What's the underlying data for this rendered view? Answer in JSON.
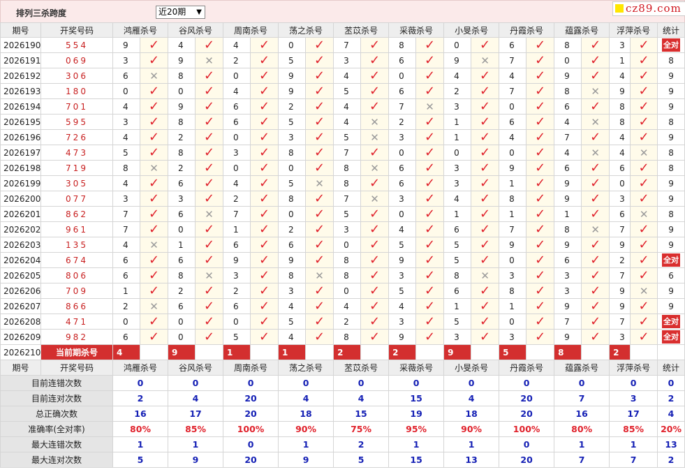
{
  "title": "排列三杀跨度",
  "period_select": "近20期",
  "logo": "cz89.com",
  "icons": {
    "correct": "check-icon",
    "wrong": "cross-icon"
  },
  "colors": {
    "accent": "#d32f2f",
    "check": "#e0212b",
    "stat_blue": "#1520b5"
  },
  "headers": [
    "期号",
    "开奖号码",
    "鸿雁杀号",
    "谷风杀号",
    "周南杀号",
    "荡之杀号",
    "苤苡杀号",
    "采薇杀号",
    "小旻杀号",
    "丹霞杀号",
    "蕴露杀号",
    "浮萍杀号",
    "统计"
  ],
  "rows": [
    {
      "id": "2026190",
      "num": "554",
      "p": [
        [
          "9",
          1
        ],
        [
          "4",
          1
        ],
        [
          "4",
          1
        ],
        [
          "0",
          1
        ],
        [
          "7",
          1
        ],
        [
          "8",
          1
        ],
        [
          "0",
          1
        ],
        [
          "6",
          1
        ],
        [
          "8",
          1
        ],
        [
          "3",
          1
        ]
      ],
      "stat": "全对"
    },
    {
      "id": "2026191",
      "num": "069",
      "p": [
        [
          "3",
          1
        ],
        [
          "9",
          0
        ],
        [
          "2",
          1
        ],
        [
          "5",
          1
        ],
        [
          "3",
          1
        ],
        [
          "6",
          1
        ],
        [
          "9",
          0
        ],
        [
          "7",
          1
        ],
        [
          "0",
          1
        ],
        [
          "1",
          1
        ]
      ],
      "stat": "8"
    },
    {
      "id": "2026192",
      "num": "306",
      "p": [
        [
          "6",
          0
        ],
        [
          "8",
          1
        ],
        [
          "0",
          1
        ],
        [
          "9",
          1
        ],
        [
          "4",
          1
        ],
        [
          "0",
          1
        ],
        [
          "4",
          1
        ],
        [
          "4",
          1
        ],
        [
          "9",
          1
        ],
        [
          "4",
          1
        ]
      ],
      "stat": "9"
    },
    {
      "id": "2026193",
      "num": "180",
      "p": [
        [
          "0",
          1
        ],
        [
          "0",
          1
        ],
        [
          "4",
          1
        ],
        [
          "9",
          1
        ],
        [
          "5",
          1
        ],
        [
          "6",
          1
        ],
        [
          "2",
          1
        ],
        [
          "7",
          1
        ],
        [
          "8",
          0
        ],
        [
          "9",
          1
        ]
      ],
      "stat": "9"
    },
    {
      "id": "2026194",
      "num": "701",
      "p": [
        [
          "4",
          1
        ],
        [
          "9",
          1
        ],
        [
          "6",
          1
        ],
        [
          "2",
          1
        ],
        [
          "4",
          1
        ],
        [
          "7",
          0
        ],
        [
          "3",
          1
        ],
        [
          "0",
          1
        ],
        [
          "6",
          1
        ],
        [
          "8",
          1
        ]
      ],
      "stat": "9"
    },
    {
      "id": "2026195",
      "num": "595",
      "p": [
        [
          "3",
          1
        ],
        [
          "8",
          1
        ],
        [
          "6",
          1
        ],
        [
          "5",
          1
        ],
        [
          "4",
          0
        ],
        [
          "2",
          1
        ],
        [
          "1",
          1
        ],
        [
          "6",
          1
        ],
        [
          "4",
          0
        ],
        [
          "8",
          1
        ]
      ],
      "stat": "8"
    },
    {
      "id": "2026196",
      "num": "726",
      "p": [
        [
          "4",
          1
        ],
        [
          "2",
          1
        ],
        [
          "0",
          1
        ],
        [
          "3",
          1
        ],
        [
          "5",
          0
        ],
        [
          "3",
          1
        ],
        [
          "1",
          1
        ],
        [
          "4",
          1
        ],
        [
          "7",
          1
        ],
        [
          "4",
          1
        ]
      ],
      "stat": "9"
    },
    {
      "id": "2026197",
      "num": "473",
      "p": [
        [
          "5",
          1
        ],
        [
          "8",
          1
        ],
        [
          "3",
          1
        ],
        [
          "8",
          1
        ],
        [
          "7",
          1
        ],
        [
          "0",
          1
        ],
        [
          "0",
          1
        ],
        [
          "0",
          1
        ],
        [
          "4",
          0
        ],
        [
          "4",
          0
        ]
      ],
      "stat": "8"
    },
    {
      "id": "2026198",
      "num": "719",
      "p": [
        [
          "8",
          0
        ],
        [
          "2",
          1
        ],
        [
          "0",
          1
        ],
        [
          "0",
          1
        ],
        [
          "8",
          0
        ],
        [
          "6",
          1
        ],
        [
          "3",
          1
        ],
        [
          "9",
          1
        ],
        [
          "6",
          1
        ],
        [
          "6",
          1
        ]
      ],
      "stat": "8"
    },
    {
      "id": "2026199",
      "num": "305",
      "p": [
        [
          "4",
          1
        ],
        [
          "6",
          1
        ],
        [
          "4",
          1
        ],
        [
          "5",
          0
        ],
        [
          "8",
          1
        ],
        [
          "6",
          1
        ],
        [
          "3",
          1
        ],
        [
          "1",
          1
        ],
        [
          "9",
          1
        ],
        [
          "0",
          1
        ]
      ],
      "stat": "9"
    },
    {
      "id": "2026200",
      "num": "077",
      "p": [
        [
          "3",
          1
        ],
        [
          "3",
          1
        ],
        [
          "2",
          1
        ],
        [
          "8",
          1
        ],
        [
          "7",
          0
        ],
        [
          "3",
          1
        ],
        [
          "4",
          1
        ],
        [
          "8",
          1
        ],
        [
          "9",
          1
        ],
        [
          "3",
          1
        ]
      ],
      "stat": "9"
    },
    {
      "id": "2026201",
      "num": "862",
      "p": [
        [
          "7",
          1
        ],
        [
          "6",
          0
        ],
        [
          "7",
          1
        ],
        [
          "0",
          1
        ],
        [
          "5",
          1
        ],
        [
          "0",
          1
        ],
        [
          "1",
          1
        ],
        [
          "1",
          1
        ],
        [
          "1",
          1
        ],
        [
          "6",
          0
        ]
      ],
      "stat": "8"
    },
    {
      "id": "2026202",
      "num": "961",
      "p": [
        [
          "7",
          1
        ],
        [
          "0",
          1
        ],
        [
          "1",
          1
        ],
        [
          "2",
          1
        ],
        [
          "3",
          1
        ],
        [
          "4",
          1
        ],
        [
          "6",
          1
        ],
        [
          "7",
          1
        ],
        [
          "8",
          0
        ],
        [
          "7",
          1
        ]
      ],
      "stat": "9"
    },
    {
      "id": "2026203",
      "num": "135",
      "p": [
        [
          "4",
          0
        ],
        [
          "1",
          1
        ],
        [
          "6",
          1
        ],
        [
          "6",
          1
        ],
        [
          "0",
          1
        ],
        [
          "5",
          1
        ],
        [
          "5",
          1
        ],
        [
          "9",
          1
        ],
        [
          "9",
          1
        ],
        [
          "9",
          1
        ]
      ],
      "stat": "9"
    },
    {
      "id": "2026204",
      "num": "674",
      "p": [
        [
          "6",
          1
        ],
        [
          "6",
          1
        ],
        [
          "9",
          1
        ],
        [
          "9",
          1
        ],
        [
          "8",
          1
        ],
        [
          "9",
          1
        ],
        [
          "5",
          1
        ],
        [
          "0",
          1
        ],
        [
          "6",
          1
        ],
        [
          "2",
          1
        ]
      ],
      "stat": "全对"
    },
    {
      "id": "2026205",
      "num": "806",
      "p": [
        [
          "6",
          1
        ],
        [
          "8",
          0
        ],
        [
          "3",
          1
        ],
        [
          "8",
          0
        ],
        [
          "8",
          1
        ],
        [
          "3",
          1
        ],
        [
          "8",
          0
        ],
        [
          "3",
          1
        ],
        [
          "3",
          1
        ],
        [
          "7",
          1
        ]
      ],
      "stat": "6"
    },
    {
      "id": "2026206",
      "num": "709",
      "p": [
        [
          "1",
          1
        ],
        [
          "2",
          1
        ],
        [
          "2",
          1
        ],
        [
          "3",
          1
        ],
        [
          "0",
          1
        ],
        [
          "5",
          1
        ],
        [
          "6",
          1
        ],
        [
          "8",
          1
        ],
        [
          "3",
          1
        ],
        [
          "9",
          0
        ]
      ],
      "stat": "9"
    },
    {
      "id": "2026207",
      "num": "866",
      "p": [
        [
          "2",
          0
        ],
        [
          "6",
          1
        ],
        [
          "6",
          1
        ],
        [
          "4",
          1
        ],
        [
          "4",
          1
        ],
        [
          "4",
          1
        ],
        [
          "1",
          1
        ],
        [
          "1",
          1
        ],
        [
          "9",
          1
        ],
        [
          "9",
          1
        ]
      ],
      "stat": "9"
    },
    {
      "id": "2026208",
      "num": "471",
      "p": [
        [
          "0",
          1
        ],
        [
          "0",
          1
        ],
        [
          "0",
          1
        ],
        [
          "5",
          1
        ],
        [
          "2",
          1
        ],
        [
          "3",
          1
        ],
        [
          "5",
          1
        ],
        [
          "0",
          1
        ],
        [
          "7",
          1
        ],
        [
          "7",
          1
        ]
      ],
      "stat": "全对"
    },
    {
      "id": "2026209",
      "num": "982",
      "p": [
        [
          "6",
          1
        ],
        [
          "0",
          1
        ],
        [
          "5",
          1
        ],
        [
          "4",
          1
        ],
        [
          "8",
          1
        ],
        [
          "9",
          1
        ],
        [
          "3",
          1
        ],
        [
          "3",
          1
        ],
        [
          "9",
          1
        ],
        [
          "3",
          1
        ]
      ],
      "stat": "全对"
    }
  ],
  "current": {
    "id": "2026210",
    "label": "当前期杀号",
    "values": [
      "4",
      "9",
      "1",
      "1",
      "2",
      "2",
      "9",
      "5",
      "8",
      "2"
    ]
  },
  "stats": [
    {
      "label": "目前连错次数",
      "values": [
        "0",
        "0",
        "0",
        "0",
        "0",
        "0",
        "0",
        "0",
        "0",
        "0",
        "0"
      ],
      "red": false
    },
    {
      "label": "目前连对次数",
      "values": [
        "2",
        "4",
        "20",
        "4",
        "4",
        "15",
        "4",
        "20",
        "7",
        "3",
        "2"
      ],
      "red": false
    },
    {
      "label": "总正确次数",
      "values": [
        "16",
        "17",
        "20",
        "18",
        "15",
        "19",
        "18",
        "20",
        "16",
        "17",
        "4"
      ],
      "red": false
    },
    {
      "label": "准确率(全对率)",
      "values": [
        "80%",
        "85%",
        "100%",
        "90%",
        "75%",
        "95%",
        "90%",
        "100%",
        "80%",
        "85%",
        "20%"
      ],
      "red": true
    },
    {
      "label": "最大连错次数",
      "values": [
        "1",
        "1",
        "0",
        "1",
        "2",
        "1",
        "1",
        "0",
        "1",
        "1",
        "13"
      ],
      "red": false
    },
    {
      "label": "最大连对次数",
      "values": [
        "5",
        "9",
        "20",
        "9",
        "5",
        "15",
        "13",
        "20",
        "7",
        "7",
        "2"
      ],
      "red": false
    }
  ]
}
